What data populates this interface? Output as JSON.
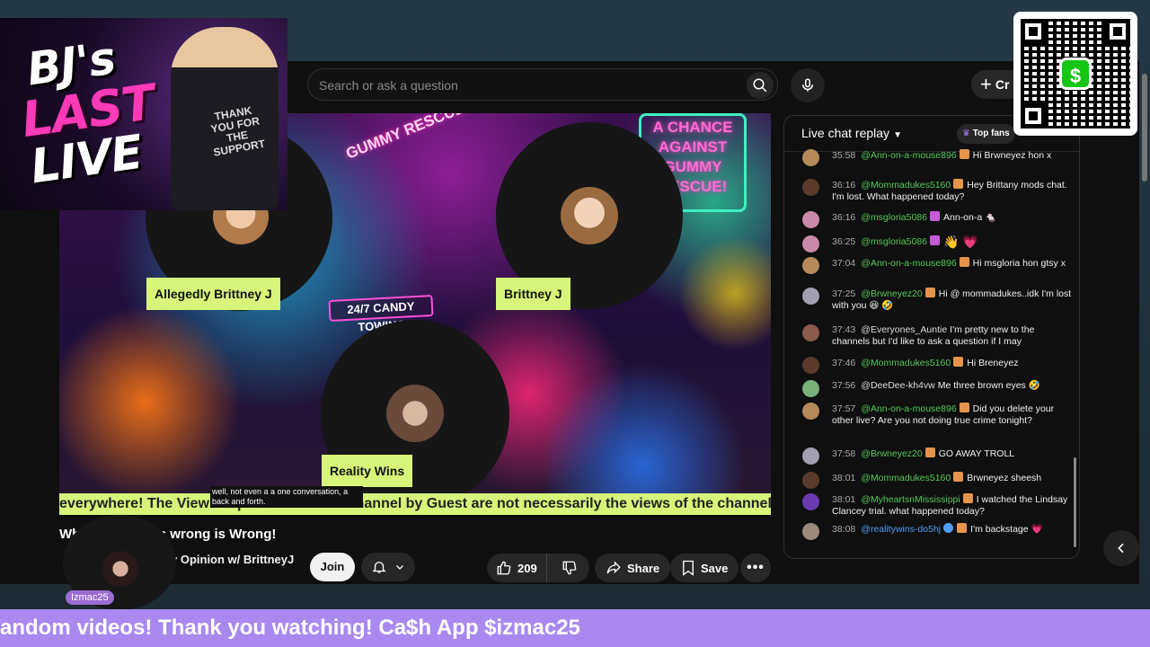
{
  "search": {
    "placeholder": "Search or ask a question"
  },
  "header": {
    "create_label": "Cr"
  },
  "video": {
    "truck_sign": "24/7 CANDY TOWING",
    "neon_sign": "A CHANCE AGAINST GUMMY RESCUE!",
    "banner": "GUMMY RESCUE",
    "participants": [
      {
        "name": "Allegedly Brittney J"
      },
      {
        "name": "Brittney J"
      },
      {
        "name": "Reality Wins"
      }
    ],
    "ticker": "everywhere! The Views expressed on this channel by Guest are not necessarily the views of the channel",
    "caption": "well, not even a a one conversation, a back and forth."
  },
  "info": {
    "title": "Wh          Right/ Whats wrong is Wrong!",
    "channel": "y Opinion w/ BrittneyJ",
    "join_label": "Join",
    "like_count": "209",
    "share_label": "Share",
    "save_label": "Save"
  },
  "chat": {
    "title": "Live chat replay",
    "top_fans": "Top fans",
    "messages": [
      {
        "time": "35:58",
        "author": "@Ann-on-a-mouse896",
        "text": "Hi Brwneyez hon x"
      },
      {
        "time": "36:16",
        "author": "@Mommadukes5160",
        "text": "Hey Brittany mods chat. I'm lost. What happened today?"
      },
      {
        "time": "36:16",
        "author": "@msgloria5086",
        "text": "Ann-on-a 🐁"
      },
      {
        "time": "36:25",
        "author": "@msgloria5086",
        "text": "👋 💗"
      },
      {
        "time": "37:04",
        "author": "@Ann-on-a-mouse896",
        "text": "Hi msgloria hon gtsy x"
      },
      {
        "time": "37:25",
        "author": "@Brwneyez20",
        "text": "Hi @ mommadukes..idk I'm lost with you 😆 🤣"
      },
      {
        "time": "37:43",
        "author": "@Everyones_Auntie",
        "text": "I'm pretty new to the channels but I'd like to ask a question if I may"
      },
      {
        "time": "37:46",
        "author": "@Mommadukes5160",
        "text": "Hi Breneyez"
      },
      {
        "time": "37:56",
        "author": "@DeeDee-kh4vw",
        "text": "Me three brown eyes 🤣"
      },
      {
        "time": "37:57",
        "author": "@Ann-on-a-mouse896",
        "text": "Did you delete your other live? Are you not doing true crime tonight?"
      },
      {
        "time": "37:58",
        "author": "@Brwneyez20",
        "text": "GO AWAY TROLL"
      },
      {
        "time": "38:01",
        "author": "@Mommadukes5160",
        "text": "Brwneyez sheesh"
      },
      {
        "time": "38:01",
        "author": "@MyheartsnMississippi",
        "text": "I watched the Lindsay Clancey trial. what happened today?"
      },
      {
        "time": "38:08",
        "author": "@realitywins-do5hj",
        "text": "I'm backstage 💗"
      }
    ]
  },
  "overlay": {
    "logo_line1": "BJ's",
    "logo_line2": "LAST",
    "logo_line3": "LIVE",
    "jacket_text": "THANK YOU FOR THE SUPPORT",
    "cash_symbol": "$",
    "cam_name": "Izmac25",
    "bottom_ticker": "andom videos! Thank you watching! Ca$h App $izmac25"
  },
  "colors": {
    "accent_green": "#d6f57a",
    "chat_author_green": "#53c95a",
    "ticker_purple": "#a989f0",
    "cashapp_green": "#16c614"
  }
}
